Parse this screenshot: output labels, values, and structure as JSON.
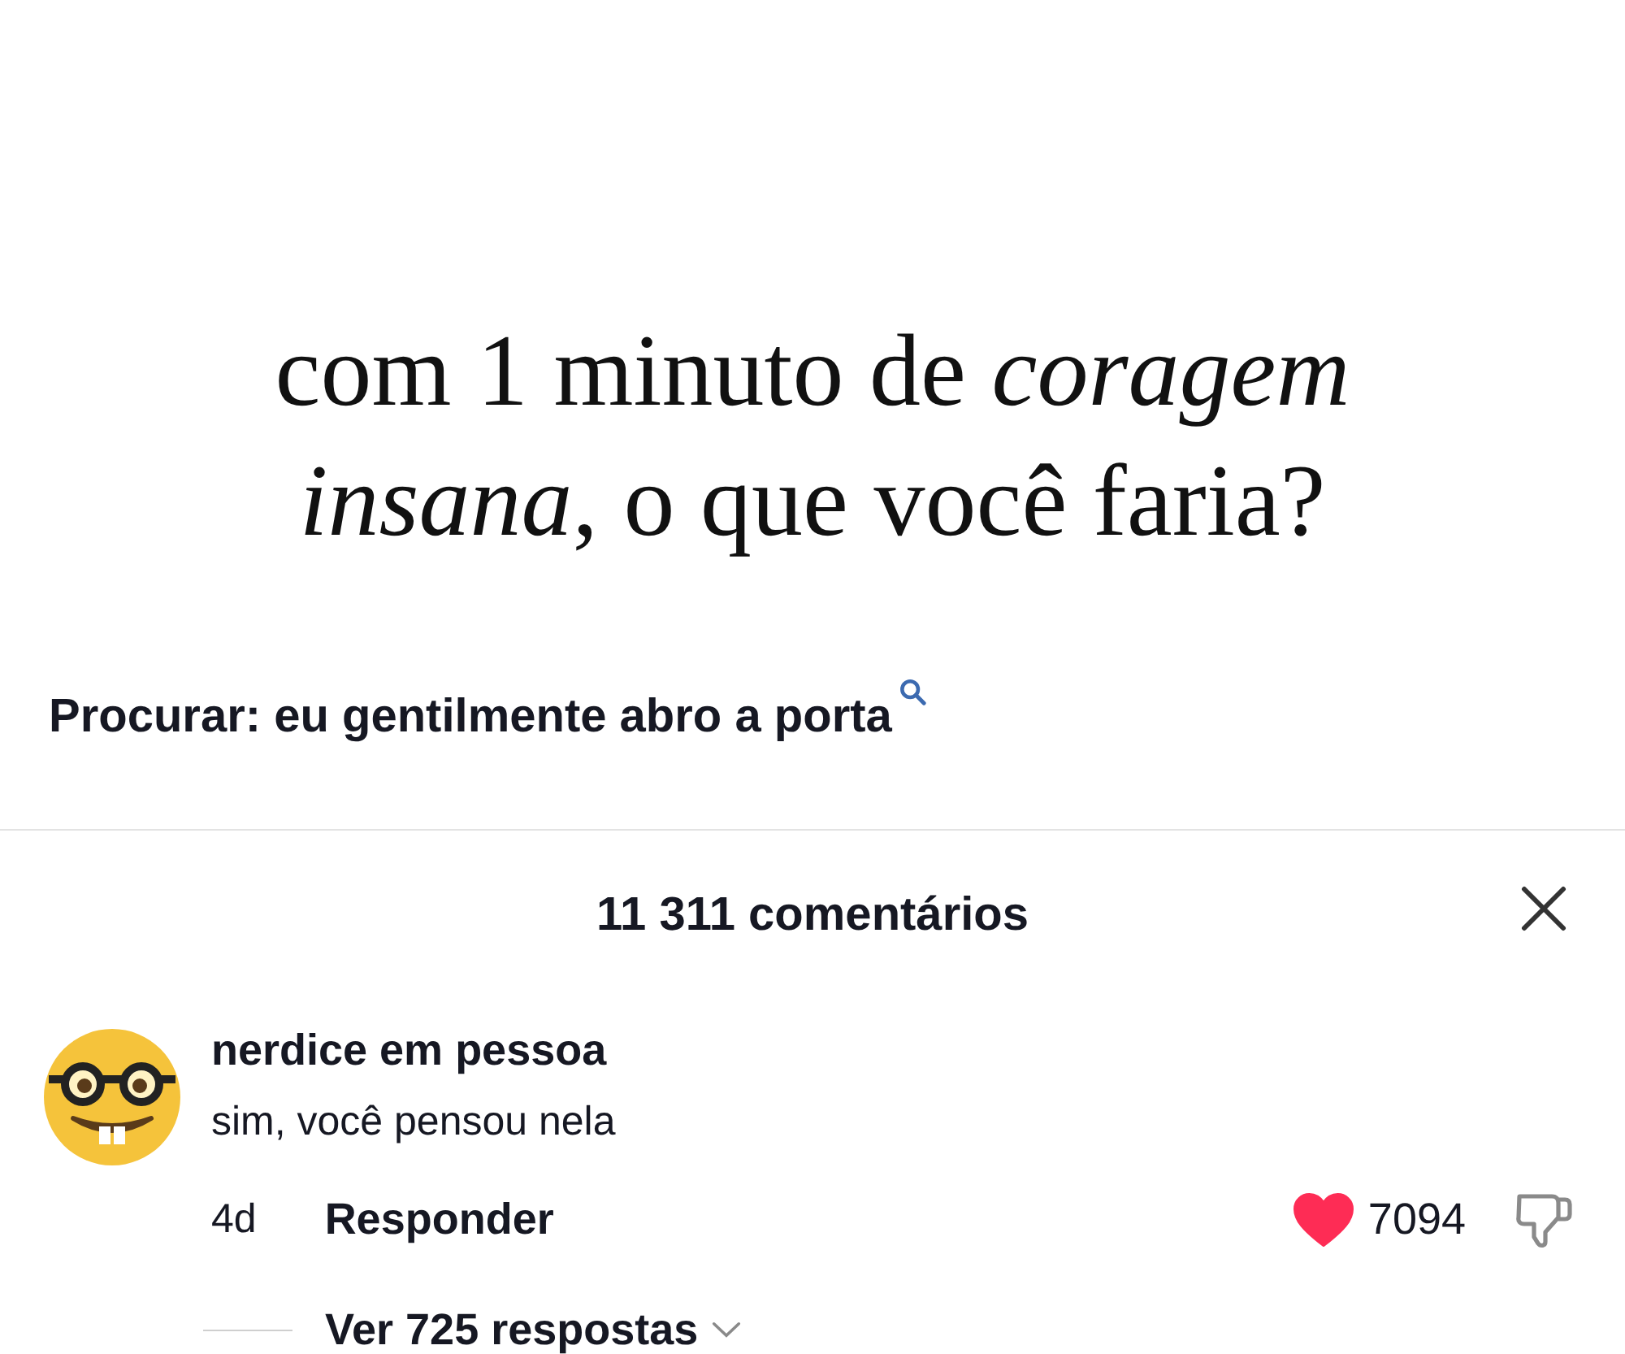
{
  "video_caption": {
    "text": "com 1 minuto de *coragem insana*, o que você faria?"
  },
  "search_suggestion": {
    "text": "Procurar: eu gentilmente abro a porta"
  },
  "comments_panel": {
    "title": "11 311 comentários",
    "comments": [
      {
        "username": "nerdice em pessoa",
        "text": "sim, você pensou nela",
        "age": "4d",
        "reply_label": "Responder",
        "liked": true,
        "like_count": "7094",
        "replies_label": "Ver 725 respostas"
      }
    ]
  }
}
